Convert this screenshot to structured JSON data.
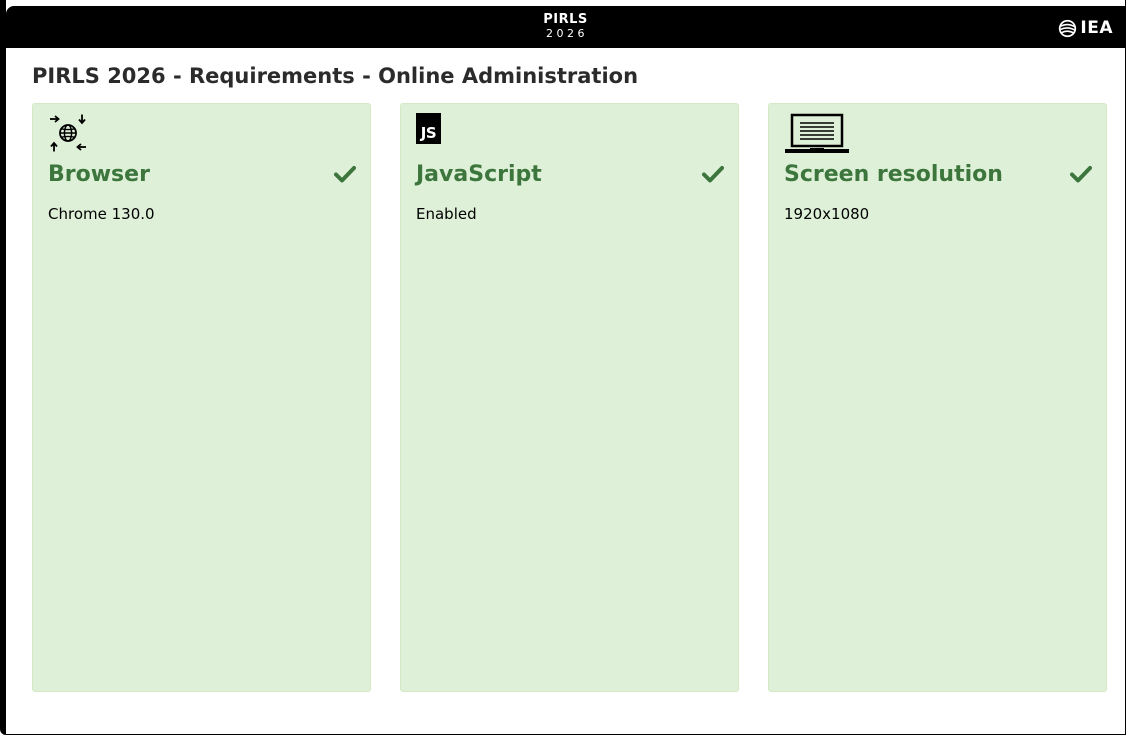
{
  "header": {
    "brand_name": "PIRLS",
    "brand_year": "2026",
    "logo_icon": "iea-globe-icon",
    "logo_text": "IEA"
  },
  "page": {
    "title": "PIRLS 2026 - Requirements - Online Administration"
  },
  "requirements": [
    {
      "icon": "browser-globe-arrows-icon",
      "title": "Browser",
      "status": "check-icon",
      "value": "Chrome 130.0"
    },
    {
      "icon": "javascript-icon",
      "icon_text": "JS",
      "title": "JavaScript",
      "status": "check-icon",
      "value": "Enabled"
    },
    {
      "icon": "laptop-icon",
      "title": "Screen resolution",
      "status": "check-icon",
      "value": "1920x1080"
    }
  ],
  "colors": {
    "header_bg": "#000000",
    "card_bg": "#dff0d8",
    "card_border": "#d6e9c6",
    "success_text": "#3c763d",
    "title_text": "#2b2b2b"
  }
}
